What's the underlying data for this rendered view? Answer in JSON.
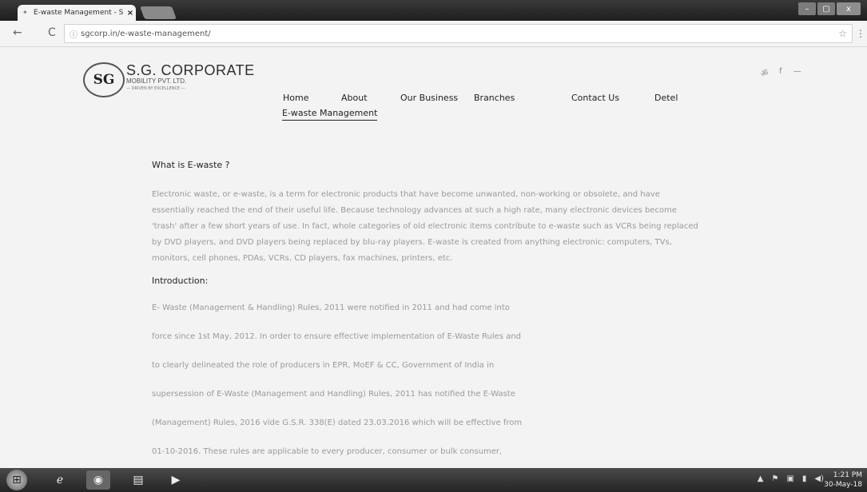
{
  "browser": {
    "tab_title": "E-waste Management - S",
    "tab_close": "×",
    "url": "sgcorp.in/e-waste-management/",
    "back": "←",
    "reload": "C",
    "info": "ⓘ",
    "star": "☆",
    "menu": "⋮",
    "window_controls": [
      "–",
      "▢",
      "x"
    ]
  },
  "site": {
    "logo_mark": "SG",
    "company_name": "S.G. CORPORATE",
    "company_sub": "MOBILITY PVT. LTD.",
    "tagline": "— DRIVEN BY EXCELLENCE —",
    "social": [
      "ॐ",
      "f",
      "—"
    ],
    "nav": [
      "Home",
      "About",
      "Our Business",
      "Branches",
      "Contact Us",
      "Detel"
    ],
    "nav_active": "E-waste Management"
  },
  "content": {
    "heading": "What is E-waste ?",
    "paragraph": "Electronic waste, or e-waste, is a term for electronic products that have become unwanted, non-working or obsolete, and have essentially reached the end of their useful life. Because technology advances at such a high rate, many electronic devices become 'trash' after a few short years of use. In fact, whole categories of old electronic items contribute to e-waste such as VCRs being replaced by DVD players, and DVD players being replaced by blu-ray players. E-waste is created from anything electronic: computers, TVs, monitors, cell phones, PDAs, VCRs, CD players, fax machines, printers, etc.",
    "intro_heading": "Introduction:",
    "intro_lines": [
      "E- Waste (Management & Handling) Rules, 2011 were notified in 2011 and had come into",
      "force since 1st May, 2012. In order to ensure effective implementation of E-Waste Rules and",
      "to clearly delineated the role of producers in EPR, MoEF & CC, Government of India in",
      "supersession of E-Waste (Management and Handling) Rules, 2011 has notified the E-Waste",
      "(Management) Rules, 2016 vide G.S.R. 338(E) dated 23.03.2016 which will be effective from",
      "01-10-2016. These rules are applicable to every producer, consumer or bulk consumer,"
    ]
  },
  "taskbar": {
    "time": "1:21 PM",
    "date": "30-May-18",
    "tray": [
      "▲",
      "⚑",
      "▣",
      "▮",
      "◀)"
    ]
  }
}
